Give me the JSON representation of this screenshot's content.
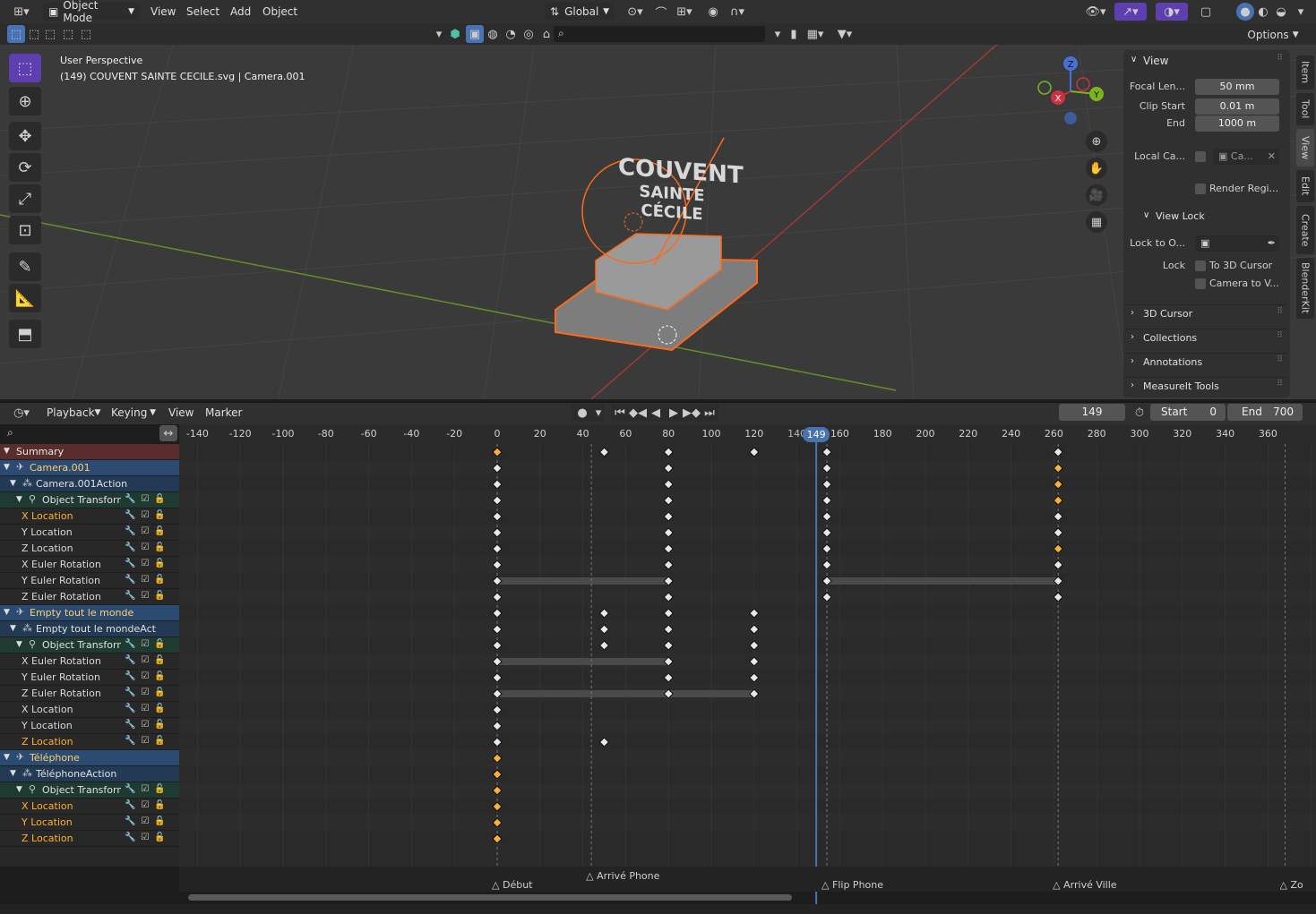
{
  "top_header": {
    "editor_type_icon": "3d-viewport-icon",
    "mode": "Object Mode",
    "menus": [
      "View",
      "Select",
      "Add",
      "Object"
    ],
    "orientation": "Global"
  },
  "viewport_header2": {
    "options_label": "Options",
    "search_placeholder": ""
  },
  "viewport": {
    "perspective_label": "User Perspective",
    "object_info": "(149) COUVENT SAINTE CECILE.svg | Camera.001",
    "model_text_line1": "COUVENT",
    "model_text_line2": "SAINTE CÉCILE",
    "gizmo_axes": [
      "Z",
      "Y",
      "X"
    ]
  },
  "npanel": {
    "view_section": "View",
    "focal_length_label": "Focal Len...",
    "focal_length_value": "50 mm",
    "clip_start_label": "Clip Start",
    "clip_start_value": "0.01 m",
    "clip_end_label": "End",
    "clip_end_value": "1000 m",
    "local_camera_label": "Local Ca...",
    "local_camera_value": "Ca...",
    "render_region_label": "Render Regi...",
    "view_lock_section": "View Lock",
    "lock_to_object_label": "Lock to O...",
    "lock_label": "Lock",
    "to_3d_cursor_label": "To 3D Cursor",
    "camera_to_view_label": "Camera to V...",
    "collapsed_sections": [
      "3D Cursor",
      "Collections",
      "Annotations",
      "MeasureIt Tools"
    ],
    "tabs": [
      "Item",
      "Tool",
      "View",
      "Edit",
      "Create",
      "BlenderKit"
    ]
  },
  "timeline_header": {
    "menus": [
      "Playback",
      "Keying",
      "View",
      "Marker"
    ],
    "current_frame": "149",
    "start_label": "Start",
    "start_value": "0",
    "end_label": "End",
    "end_value": "700"
  },
  "dopesheet": {
    "ticks": [
      "-140",
      "-120",
      "-100",
      "-80",
      "-60",
      "-40",
      "-20",
      "0",
      "20",
      "40",
      "60",
      "80",
      "100",
      "120",
      "140",
      "160",
      "180",
      "200",
      "220",
      "240",
      "260",
      "280",
      "300",
      "320",
      "340",
      "360"
    ],
    "current_frame_badge": "149",
    "markers": [
      {
        "label": "Début",
        "frame": 0
      },
      {
        "label": "Arrivé Phone",
        "frame": 44
      },
      {
        "label": "Flip Phone",
        "frame": 154
      },
      {
        "label": "Arrivé Ville",
        "frame": 262
      },
      {
        "label": "Zo",
        "frame": 368
      }
    ],
    "channels": [
      {
        "label": "Summary",
        "kind": "summary",
        "indent": 0
      },
      {
        "label": "Camera.001",
        "kind": "object",
        "indent": 0
      },
      {
        "label": "Camera.001Action",
        "kind": "action",
        "indent": 1
      },
      {
        "label": "Object Transforn",
        "kind": "group",
        "indent": 2
      },
      {
        "label": "X Location",
        "kind": "fcurve-hl",
        "indent": 3
      },
      {
        "label": "Y Location",
        "kind": "fcurve",
        "indent": 3
      },
      {
        "label": "Z Location",
        "kind": "fcurve",
        "indent": 3
      },
      {
        "label": "X Euler Rotation",
        "kind": "fcurve",
        "indent": 3
      },
      {
        "label": "Y Euler Rotation",
        "kind": "fcurve",
        "indent": 3
      },
      {
        "label": "Z Euler Rotation",
        "kind": "fcurve",
        "indent": 3
      },
      {
        "label": "Empty tout le monde",
        "kind": "object",
        "indent": 0
      },
      {
        "label": "Empty tout le mondeAction",
        "kind": "action",
        "indent": 1
      },
      {
        "label": "Object Transforn",
        "kind": "group",
        "indent": 2
      },
      {
        "label": "X Euler Rotation",
        "kind": "fcurve",
        "indent": 3
      },
      {
        "label": "Y Euler Rotation",
        "kind": "fcurve",
        "indent": 3
      },
      {
        "label": "Z Euler Rotation",
        "kind": "fcurve",
        "indent": 3
      },
      {
        "label": "X Location",
        "kind": "fcurve",
        "indent": 3
      },
      {
        "label": "Y Location",
        "kind": "fcurve",
        "indent": 3
      },
      {
        "label": "Z Location",
        "kind": "fcurve-hl",
        "indent": 3
      },
      {
        "label": "Téléphone",
        "kind": "object",
        "indent": 0
      },
      {
        "label": "TéléphoneAction",
        "kind": "action",
        "indent": 1
      },
      {
        "label": "Object Transforn",
        "kind": "group",
        "indent": 2
      },
      {
        "label": "X Location",
        "kind": "fcurve-hl",
        "indent": 3
      },
      {
        "label": "Y Location",
        "kind": "fcurve-hl",
        "indent": 3
      },
      {
        "label": "Z Location",
        "kind": "fcurve-hl",
        "indent": 3
      }
    ],
    "keyframes": [
      {
        "row": 0,
        "frames": [
          0,
          50,
          80,
          120,
          154,
          262
        ],
        "sel": [
          0
        ]
      },
      {
        "row": 1,
        "frames": [
          0,
          80,
          154,
          262
        ],
        "sel": [
          262
        ]
      },
      {
        "row": 2,
        "frames": [
          0,
          80,
          154,
          262
        ],
        "sel": [
          262
        ]
      },
      {
        "row": 3,
        "frames": [
          0,
          80,
          154,
          262
        ],
        "sel": [
          262
        ]
      },
      {
        "row": 4,
        "frames": [
          0,
          80,
          154,
          262
        ],
        "sel": []
      },
      {
        "row": 5,
        "frames": [
          0,
          80,
          154,
          262
        ],
        "sel": []
      },
      {
        "row": 6,
        "frames": [
          0,
          80,
          154,
          262
        ],
        "sel": [
          262
        ]
      },
      {
        "row": 7,
        "frames": [
          0,
          80,
          154,
          262
        ],
        "sel": []
      },
      {
        "row": 8,
        "frames": [
          0,
          80,
          154,
          262
        ],
        "sel": []
      },
      {
        "row": 9,
        "frames": [
          0,
          80,
          154,
          262
        ],
        "sel": []
      },
      {
        "row": 10,
        "frames": [
          0,
          50,
          80,
          120
        ],
        "sel": []
      },
      {
        "row": 11,
        "frames": [
          0,
          50,
          80,
          120
        ],
        "sel": []
      },
      {
        "row": 12,
        "frames": [
          0,
          50,
          80,
          120
        ],
        "sel": []
      },
      {
        "row": 13,
        "frames": [
          0,
          80,
          120
        ],
        "sel": []
      },
      {
        "row": 14,
        "frames": [
          0,
          80,
          120
        ],
        "sel": []
      },
      {
        "row": 15,
        "frames": [
          0,
          80,
          120
        ],
        "sel": []
      },
      {
        "row": 16,
        "frames": [
          0
        ],
        "sel": []
      },
      {
        "row": 17,
        "frames": [
          0
        ],
        "sel": []
      },
      {
        "row": 18,
        "frames": [
          0,
          50
        ],
        "sel": []
      },
      {
        "row": 19,
        "frames": [
          0
        ],
        "sel": [
          0
        ]
      },
      {
        "row": 20,
        "frames": [
          0
        ],
        "sel": [
          0
        ]
      },
      {
        "row": 21,
        "frames": [
          0
        ],
        "sel": [
          0
        ]
      },
      {
        "row": 22,
        "frames": [
          0
        ],
        "sel": [
          0
        ]
      },
      {
        "row": 23,
        "frames": [
          0
        ],
        "sel": [
          0
        ]
      },
      {
        "row": 24,
        "frames": [
          0
        ],
        "sel": [
          0
        ]
      }
    ],
    "holds": [
      {
        "row": 8,
        "from": 0,
        "to": 80
      },
      {
        "row": 8,
        "from": 154,
        "to": 262
      },
      {
        "row": 13,
        "from": 0,
        "to": 80
      },
      {
        "row": 15,
        "from": 0,
        "to": 120
      }
    ]
  }
}
